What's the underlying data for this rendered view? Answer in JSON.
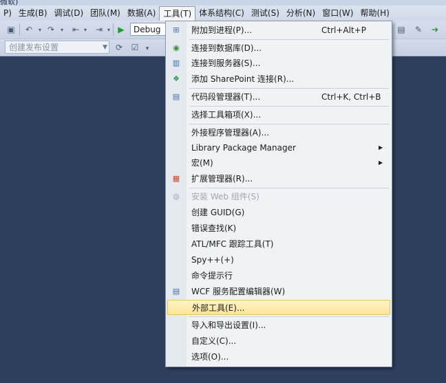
{
  "window": {
    "title_fragment": "微软)"
  },
  "menubar": {
    "items": [
      {
        "label": "P)"
      },
      {
        "label": "生成(B)"
      },
      {
        "label": "调试(D)"
      },
      {
        "label": "团队(M)"
      },
      {
        "label": "数据(A)"
      },
      {
        "label": "工具(T)"
      },
      {
        "label": "体系结构(C)"
      },
      {
        "label": "测试(S)"
      },
      {
        "label": "分析(N)"
      },
      {
        "label": "窗口(W)"
      },
      {
        "label": "帮助(H)"
      }
    ],
    "active_index": 5
  },
  "toolbar": {
    "configuration": "Debug",
    "publish_placeholder": "创建发布设置"
  },
  "tools_menu": {
    "items": [
      {
        "label": "附加到进程(P)...",
        "shortcut": "Ctrl+Alt+P",
        "icon": "attach-process-icon"
      },
      {
        "label": "连接到数据库(D)...",
        "icon": "connect-database-icon"
      },
      {
        "label": "连接到服务器(S)...",
        "icon": "connect-server-icon"
      },
      {
        "label": "添加 SharePoint 连接(R)...",
        "icon": "sharepoint-icon"
      },
      {
        "label": "代码段管理器(T)...",
        "shortcut": "Ctrl+K, Ctrl+B",
        "icon": "snippet-manager-icon"
      },
      {
        "label": "选择工具箱项(X)..."
      },
      {
        "label": "外接程序管理器(A)..."
      },
      {
        "label": "Library Package Manager",
        "submenu": true
      },
      {
        "label": "宏(M)",
        "submenu": true
      },
      {
        "label": "扩展管理器(R)...",
        "icon": "extension-manager-icon"
      },
      {
        "label": "安装 Web 组件(S)",
        "disabled": true,
        "icon": "web-component-icon"
      },
      {
        "label": "创建 GUID(G)"
      },
      {
        "label": "错误查找(K)"
      },
      {
        "label": "ATL/MFC 跟踪工具(T)"
      },
      {
        "label": "Spy++(+)"
      },
      {
        "label": "命令提示行"
      },
      {
        "label": "WCF 服务配置编辑器(W)",
        "icon": "wcf-editor-icon"
      },
      {
        "label": "外部工具(E)...",
        "highlighted": true
      },
      {
        "label": "导入和导出设置(I)..."
      },
      {
        "label": "自定义(C)..."
      },
      {
        "label": "选项(O)..."
      }
    ]
  },
  "colors": {
    "workspace": "#2e3f5e",
    "highlight": "#ffe59a",
    "menu_bg": "#f0f2f6"
  }
}
